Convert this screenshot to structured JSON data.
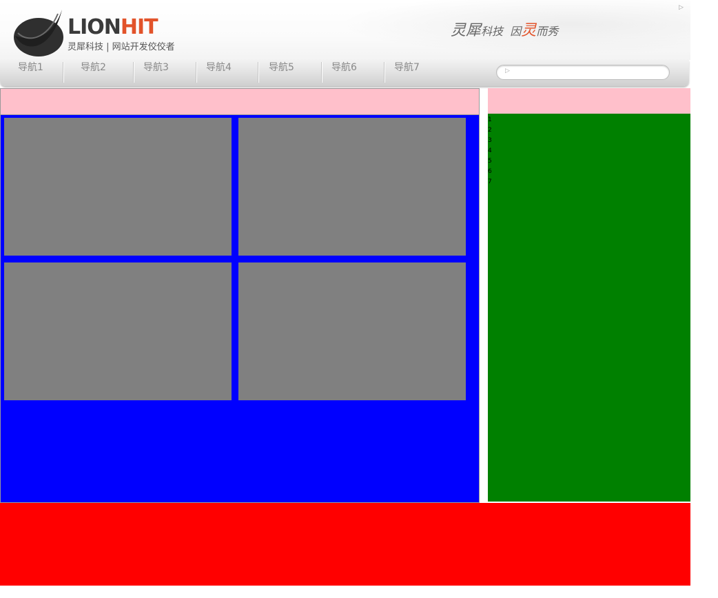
{
  "header": {
    "logo_lion": "LION",
    "logo_hit": "HIT",
    "logo_subtitle": "灵犀科技 | 网站开发佼佼者",
    "slogan": {
      "part1": "灵犀",
      "part2": "科技",
      "part3": "因",
      "accent": "灵",
      "part4": "而秀"
    }
  },
  "nav": {
    "items": [
      {
        "label": "导航1"
      },
      {
        "label": "导航2"
      },
      {
        "label": "导航3"
      },
      {
        "label": "导航4"
      },
      {
        "label": "导航5"
      },
      {
        "label": "导航6"
      },
      {
        "label": "导航7"
      }
    ],
    "search": {
      "value": "",
      "placeholder": ""
    }
  },
  "sidebar": {
    "items": [
      "1",
      "2",
      "3",
      "4",
      "5",
      "6",
      "7"
    ]
  },
  "colors": {
    "main_bg": "#0000ff",
    "tile": "#808080",
    "header_bar": "#ffc0cb",
    "sidebar_bg": "#008000",
    "footer_bg": "#ff0000",
    "brand_accent": "#e2532a"
  },
  "icons": {
    "logo": "lion-claw-logo",
    "search": "play-arrow-icon",
    "corner": "play-arrow-icon"
  }
}
